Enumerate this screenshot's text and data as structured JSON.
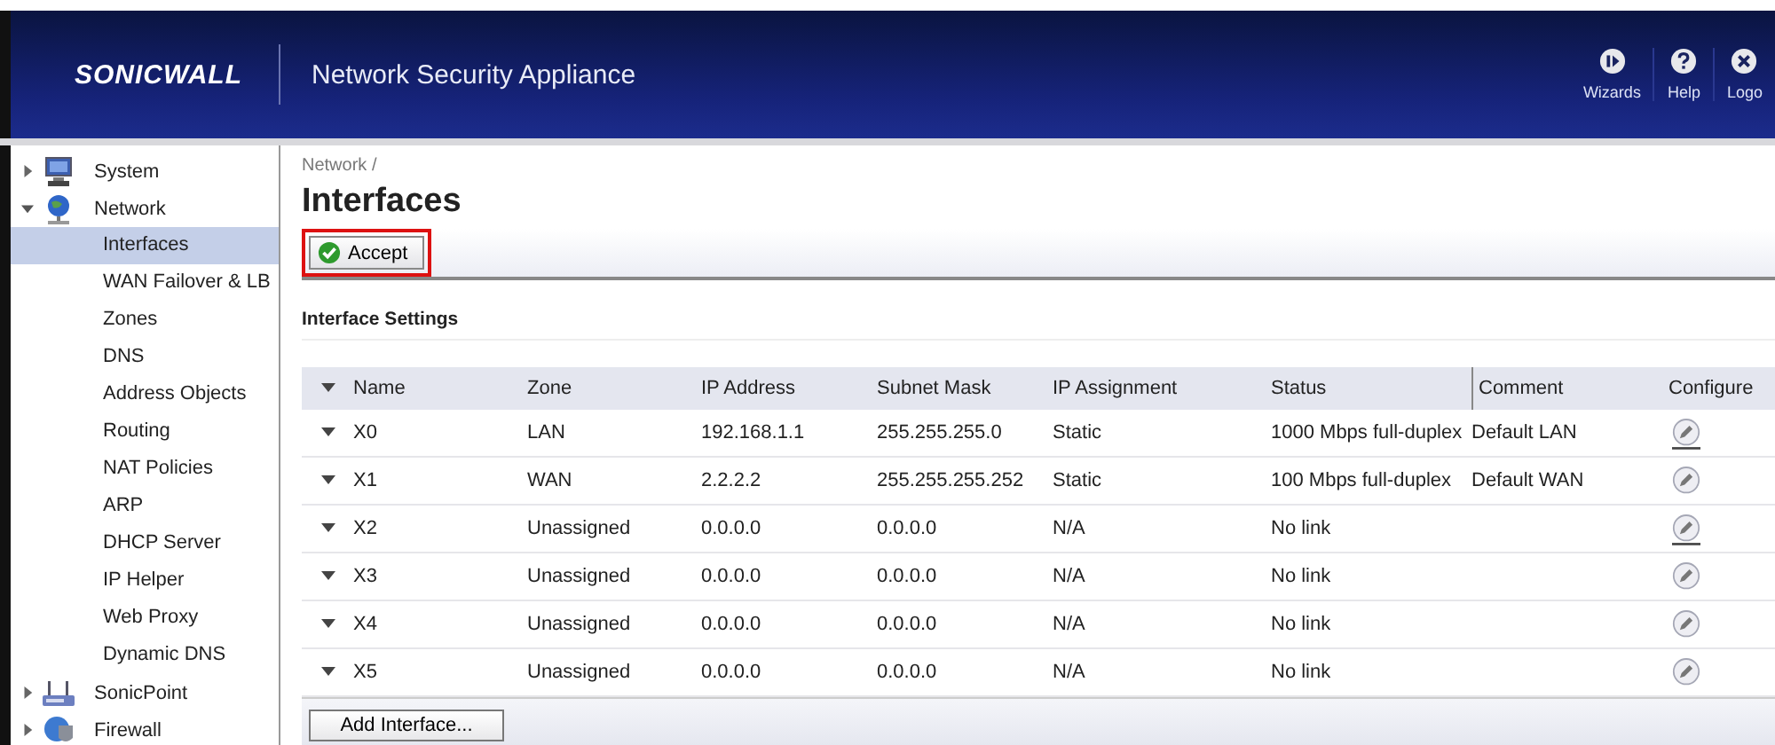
{
  "header": {
    "logo": "SONICWALL",
    "title": "Network Security Appliance",
    "actions": [
      {
        "kind": "wizards",
        "label": "Wizards"
      },
      {
        "kind": "help",
        "label": "Help"
      },
      {
        "kind": "logout",
        "label": "Logo"
      }
    ]
  },
  "sidebar": {
    "items": [
      {
        "label": "System",
        "kind": "system",
        "expanded": false,
        "selected": false
      },
      {
        "label": "Network",
        "kind": "network",
        "expanded": true,
        "selected": false,
        "children": [
          {
            "label": "Interfaces",
            "selected": true
          },
          {
            "label": "WAN Failover & LB",
            "selected": false
          },
          {
            "label": "Zones",
            "selected": false
          },
          {
            "label": "DNS",
            "selected": false
          },
          {
            "label": "Address Objects",
            "selected": false
          },
          {
            "label": "Routing",
            "selected": false
          },
          {
            "label": "NAT Policies",
            "selected": false
          },
          {
            "label": "ARP",
            "selected": false
          },
          {
            "label": "DHCP Server",
            "selected": false
          },
          {
            "label": "IP Helper",
            "selected": false
          },
          {
            "label": "Web Proxy",
            "selected": false
          },
          {
            "label": "Dynamic DNS",
            "selected": false
          }
        ]
      },
      {
        "label": "SonicPoint",
        "kind": "sonicpoint",
        "expanded": false,
        "selected": false
      },
      {
        "label": "Firewall",
        "kind": "firewall",
        "expanded": false,
        "selected": false
      }
    ]
  },
  "breadcrumb": "Network /",
  "page_title": "Interfaces",
  "toolbar": {
    "accept_button": "Accept",
    "highlighted": true
  },
  "section_title": "Interface Settings",
  "table": {
    "columns": [
      "Name",
      "Zone",
      "IP Address",
      "Subnet Mask",
      "IP Assignment",
      "Status",
      "Comment",
      "Configure"
    ],
    "rows": [
      {
        "name": "X0",
        "zone": "LAN",
        "ip_address": "192.168.1.1",
        "subnet_mask": "255.255.255.0",
        "ip_assignment": "Static",
        "status": "1000 Mbps full-duplex",
        "comment": "Default LAN",
        "configure_underlined": true
      },
      {
        "name": "X1",
        "zone": "WAN",
        "ip_address": "2.2.2.2",
        "subnet_mask": "255.255.255.252",
        "ip_assignment": "Static",
        "status": "100 Mbps full-duplex",
        "comment": "Default WAN",
        "configure_underlined": false
      },
      {
        "name": "X2",
        "zone": "Unassigned",
        "ip_address": "0.0.0.0",
        "subnet_mask": "0.0.0.0",
        "ip_assignment": "N/A",
        "status": "No link",
        "configure_underlined": true
      },
      {
        "name": "X3",
        "zone": "Unassigned",
        "ip_address": "0.0.0.0",
        "subnet_mask": "0.0.0.0",
        "ip_assignment": "N/A",
        "status": "No link",
        "configure_underlined": false
      },
      {
        "name": "X4",
        "zone": "Unassigned",
        "ip_address": "0.0.0.0",
        "subnet_mask": "0.0.0.0",
        "ip_assignment": "N/A",
        "status": "No link",
        "configure_underlined": false
      },
      {
        "name": "X5",
        "zone": "Unassigned",
        "ip_address": "0.0.0.0",
        "subnet_mask": "0.0.0.0",
        "ip_assignment": "N/A",
        "status": "No link",
        "configure_underlined": false
      }
    ]
  },
  "add_button": "Add Interface..."
}
